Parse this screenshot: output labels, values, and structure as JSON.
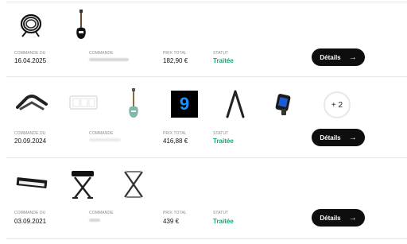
{
  "orders": [
    {
      "date_label": "COMMANDE DU",
      "date": "16.04.2025",
      "order_label": "COMMANDE",
      "price_label": "PRIX TOTAL",
      "price": "182,90 €",
      "status_label": "STATUT",
      "status": "Traitée",
      "button": "Détails",
      "items": [
        "cable-coil-icon",
        "electric-bass-icon"
      ]
    },
    {
      "date_label": "COMMANDE DU",
      "date": "20.09.2024",
      "order_label": "COMMANDE",
      "price_label": "PRIX TOTAL",
      "price": "416,88 €",
      "status_label": "STATUT",
      "status": "Traitée",
      "button": "Détails",
      "extra_count": "+ 2",
      "album_cover_text": "9",
      "items": [
        "guitar-capo-icon",
        "pedal-board-icon",
        "electric-guitar-icon",
        "album-cover-icon",
        "guitar-stand-icon",
        "clip-tuner-icon"
      ]
    },
    {
      "date_label": "COMMANDE DU",
      "date": "03.09.2021",
      "order_label": "COMMANDE",
      "price_label": "PRIX TOTAL",
      "price": "439 €",
      "status_label": "STATUT",
      "status": "Traitée",
      "button": "Détails",
      "items": [
        "digital-piano-icon",
        "keyboard-bench-icon",
        "keyboard-stand-icon"
      ]
    }
  ],
  "colors": {
    "status": "#1aa36f",
    "button_bg": "#0e0e0e"
  }
}
